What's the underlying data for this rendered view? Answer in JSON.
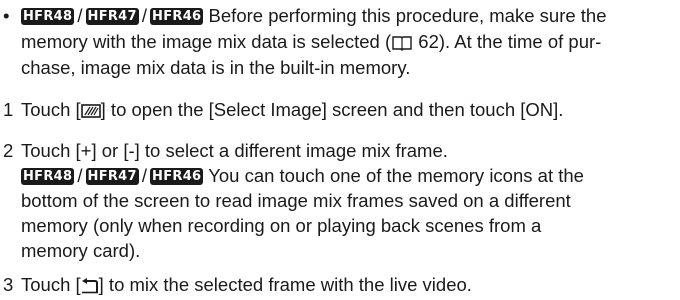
{
  "note": {
    "bullet": "•",
    "models": [
      "HFR48",
      "HFR47",
      "HFR46"
    ],
    "line1_text": "Before performing this procedure, make sure the",
    "line2_pre": "memory with the image mix data is selected (",
    "line2_ref": "62",
    "line2_post": "). At the time of pur-",
    "line3": "chase, image mix data is in the built-in memory."
  },
  "steps": [
    {
      "number": "1",
      "pre": "Touch [",
      "icon": "image-mix-icon",
      "post": "] to open the [Select Image] screen and then touch [ON]."
    },
    {
      "number": "2",
      "text": "Touch [+] or [-] to select a different image mix frame.",
      "models": [
        "HFR48",
        "HFR47",
        "HFR46"
      ],
      "detail_line1": "You can touch one of the memory icons at the",
      "detail_line2": "bottom of the screen to read image mix frames saved on a different",
      "detail_line3": "memory (only when recording on or playing back scenes from a",
      "detail_line4": "memory card)."
    },
    {
      "number": "3",
      "pre": "Touch [",
      "icon": "return-icon",
      "post": "] to mix the selected frame with the live video."
    }
  ]
}
